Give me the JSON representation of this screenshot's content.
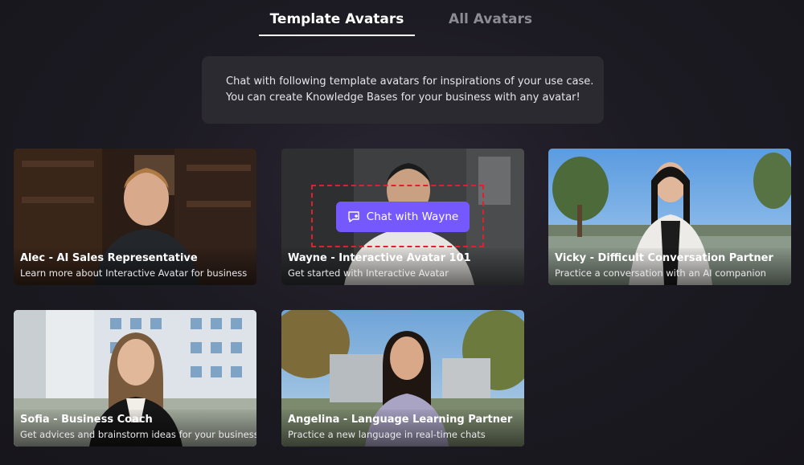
{
  "tabs": [
    {
      "label": "Template Avatars",
      "active": true
    },
    {
      "label": "All Avatars",
      "active": false
    }
  ],
  "info": {
    "line1": "Chat with following template avatars for inspirations of your use case.",
    "line2": "You can create Knowledge Bases for your business with any avatar!"
  },
  "avatars": [
    {
      "name": "Alec - AI Sales Representative",
      "description": "Learn more about Interactive Avatar for business"
    },
    {
      "name": "Wayne - Interactive Avatar 101",
      "description": "Get started with Interactive Avatar"
    },
    {
      "name": "Vicky - Difficult Conversation Partner",
      "description": "Practice a conversation with an AI companion"
    },
    {
      "name": "Sofia - Business Coach",
      "description": "Get advices and brainstorm ideas for your business"
    },
    {
      "name": "Angelina - Language Learning Partner",
      "description": "Practice a new language in real-time chats"
    }
  ],
  "hover_button": {
    "label": "Chat with Wayne",
    "icon": "chat-plus-icon"
  },
  "colors": {
    "accent": "#7559ff",
    "highlight_dash": "#e0202a"
  }
}
